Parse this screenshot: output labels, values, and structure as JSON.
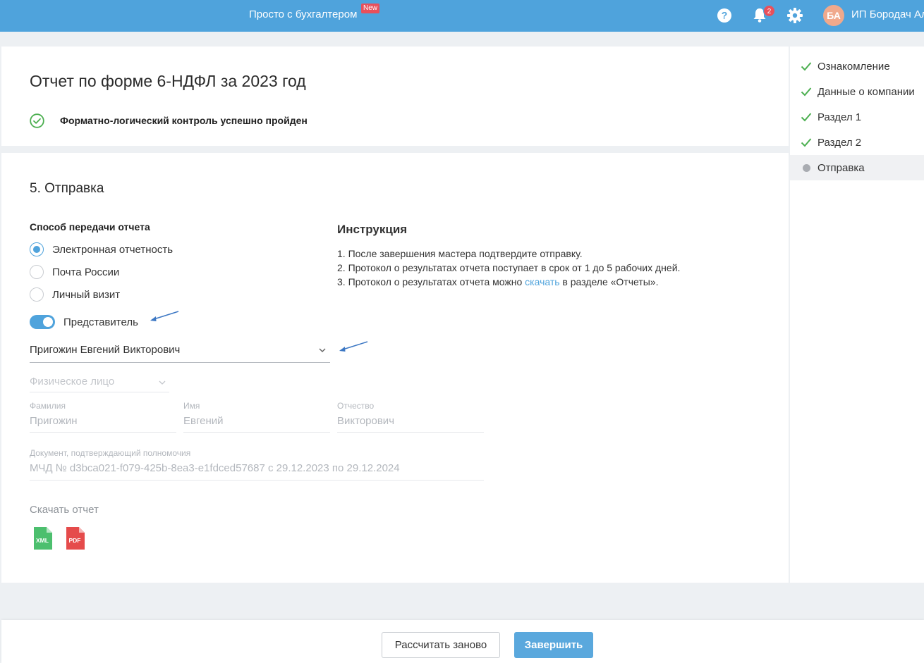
{
  "header": {
    "app_link": "Просто с бухгалтером",
    "new_badge": "New",
    "notifications_count": "2",
    "avatar_initials": "БА",
    "user_name": "ИП Бородач Ал"
  },
  "report": {
    "title": "Отчет по форме 6-НДФЛ за 2023 год",
    "flk_status": "Форматно-логический контроль успешно пройден"
  },
  "send": {
    "section_title": "5. Отправка",
    "method_label": "Способ передачи отчета",
    "methods": [
      {
        "label": "Электронная отчетность",
        "checked": true
      },
      {
        "label": "Почта России",
        "checked": false
      },
      {
        "label": "Личный визит",
        "checked": false
      }
    ],
    "representative_toggle_label": "Представитель",
    "representative_toggle_on": true,
    "representative_value": "Пригожин Евгений Викторович",
    "person_type_value": "Физическое лицо",
    "last_name_label": "Фамилия",
    "last_name_value": "Пригожин",
    "first_name_label": "Имя",
    "first_name_value": "Евгений",
    "middle_name_label": "Отчество",
    "middle_name_value": "Викторович",
    "doc_label": "Документ, подтверждающий полномочия",
    "doc_value": "МЧД № d3bca021-f079-425b-8ea3-e1fdced57687 с 29.12.2023 по 29.12.2024",
    "download_label": "Скачать отчет",
    "xml_label": "XML",
    "pdf_label": "PDF"
  },
  "instructions": {
    "title": "Инструкция",
    "line1": "1. После завершения мастера подтвердите отправку.",
    "line2": "2. Протокол о результатах отчета поступает в срок от 1 до 5 рабочих дней.",
    "line3_before": "3. Протокол о результатах отчета можно ",
    "line3_link": "скачать",
    "line3_after": " в разделе «Отчеты»."
  },
  "steps": [
    {
      "label": "Ознакомление",
      "status": "done"
    },
    {
      "label": "Данные о компании",
      "status": "done"
    },
    {
      "label": "Раздел 1",
      "status": "done"
    },
    {
      "label": "Раздел 2",
      "status": "done"
    },
    {
      "label": "Отправка",
      "status": "current"
    }
  ],
  "footer": {
    "recalc_label": "Рассчитать заново",
    "finish_label": "Завершить"
  },
  "colors": {
    "accent": "#4fa3dc",
    "success": "#4caf50",
    "badge": "#e8505b",
    "xml": "#4cbf6e",
    "pdf": "#e54b4b"
  },
  "icons": [
    "help-icon",
    "bell-icon",
    "gear-icon",
    "check-circle-icon",
    "check-icon",
    "chevron-down-icon",
    "xml-file-icon",
    "pdf-file-icon"
  ]
}
